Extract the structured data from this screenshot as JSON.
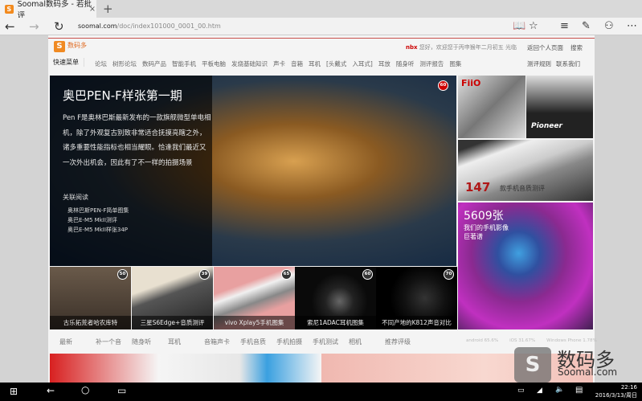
{
  "browser": {
    "tab_title": "Soomal数码多 - 若批评",
    "url_host": "soomal.com",
    "url_path": "/doc/index101000_0001_00.htm"
  },
  "header": {
    "logo_text": "数码多",
    "user": "nbx",
    "welcome": "您好，欢迎您于丙申猴年二月初五 光临",
    "links": [
      "返回个人页面",
      "搜索"
    ]
  },
  "nav": {
    "menu": "快速菜单",
    "links": [
      "论坛",
      "树形论坛",
      "数码产品",
      "智能手机",
      "平板电脑",
      "发烧基础知识",
      "声卡",
      "音箱",
      "耳机",
      "[头戴式",
      "入耳式]",
      "耳放",
      "随身听",
      "测评报告",
      "图集"
    ],
    "right": [
      "测评规则",
      "联系我们"
    ]
  },
  "hero": {
    "title": "奥巴PEN-F样张第一期",
    "description": "Pen F是奥林巴斯最新发布的一款旗舰微型单电相机，除了外观复古别致非常适合抚摸亮瞎之外，诸多重要性能指标也相当耀眼。恰逢我们最近又一次外出机会，因此有了不一样的拍摄场景",
    "badge": "60",
    "related_label": "关联阅读",
    "related": [
      "奥林巴斯PEN-F简单图集",
      "奥巴E-M5 MkII测评",
      "奥巴E-M5 MkII样张34P"
    ]
  },
  "thumbs": [
    {
      "caption": "古乐拓荒者哈农库特",
      "badge": "50"
    },
    {
      "caption": "三星S6Edge+音质测评",
      "badge": "39"
    },
    {
      "caption": "vivo Xplay5手机图集",
      "badge": "65"
    },
    {
      "caption": "索尼1ADAC耳机图集",
      "badge": "60"
    },
    {
      "caption": "不同产地的K812声音对比",
      "badge": "70"
    }
  ],
  "right_tiles": {
    "fiio_label": "FiiO",
    "pioneer_label": "Pioneer",
    "count": "147",
    "count_label": "款手机音质测评",
    "photos_count": "5609张",
    "photos_line1": "我们的手机影像",
    "photos_line2": "巨著谱"
  },
  "subnav": [
    "最新",
    "补一个音",
    "随身听",
    "耳机",
    "音箱声卡",
    "手机音质",
    "手机拍摄",
    "手机测试",
    "相机",
    "推荐评级"
  ],
  "stats": [
    "android 65.6%",
    "iOS 31.67%",
    "Windows Phone 1.78%"
  ],
  "watermark": {
    "cn": "数码多",
    "en": "Soomal.com"
  },
  "taskbar": {
    "time": "22:16",
    "date": "2016/3/13/周日"
  }
}
